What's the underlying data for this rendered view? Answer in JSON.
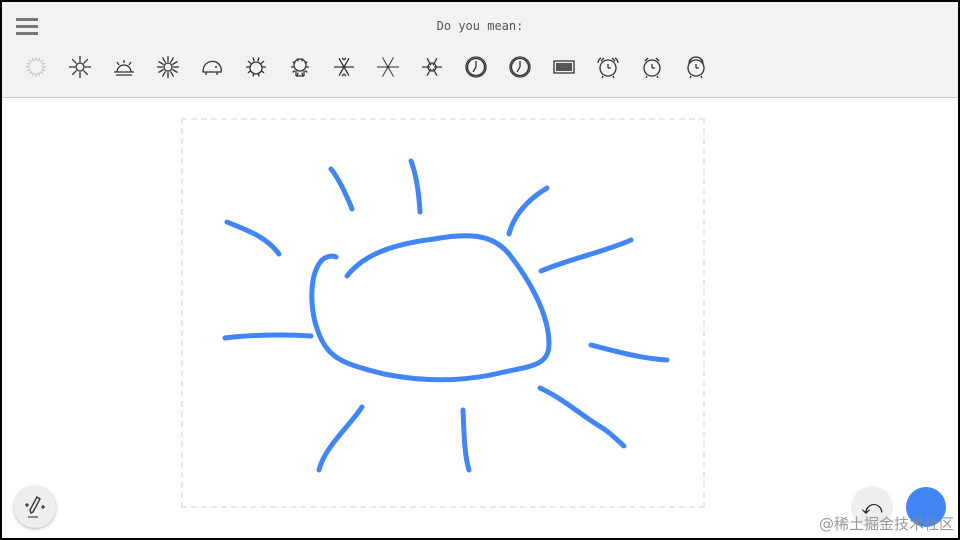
{
  "header": {
    "title": "Do you mean:"
  },
  "suggestions": [
    {
      "name": "sun-sketch-icon"
    },
    {
      "name": "sun-icon"
    },
    {
      "name": "sunrise-icon"
    },
    {
      "name": "sun-rays-icon"
    },
    {
      "name": "hedgehog-icon"
    },
    {
      "name": "hedgehog-face-icon"
    },
    {
      "name": "hedgehog-standing-icon"
    },
    {
      "name": "snowflake-icon"
    },
    {
      "name": "snowflake-thin-icon"
    },
    {
      "name": "snowflake-outline-icon"
    },
    {
      "name": "clock-icon"
    },
    {
      "name": "clock-2-icon"
    },
    {
      "name": "digital-clock-icon"
    },
    {
      "name": "alarm-clock-ringing-icon"
    },
    {
      "name": "alarm-clock-icon"
    },
    {
      "name": "alarm-clock-bells-icon"
    }
  ],
  "tools": {
    "undo_glyph": "⤺"
  },
  "colors": {
    "stroke": "#4285f4",
    "toolbar": "#f2f2f2"
  },
  "watermark": "@稀土掘金技术社区"
}
